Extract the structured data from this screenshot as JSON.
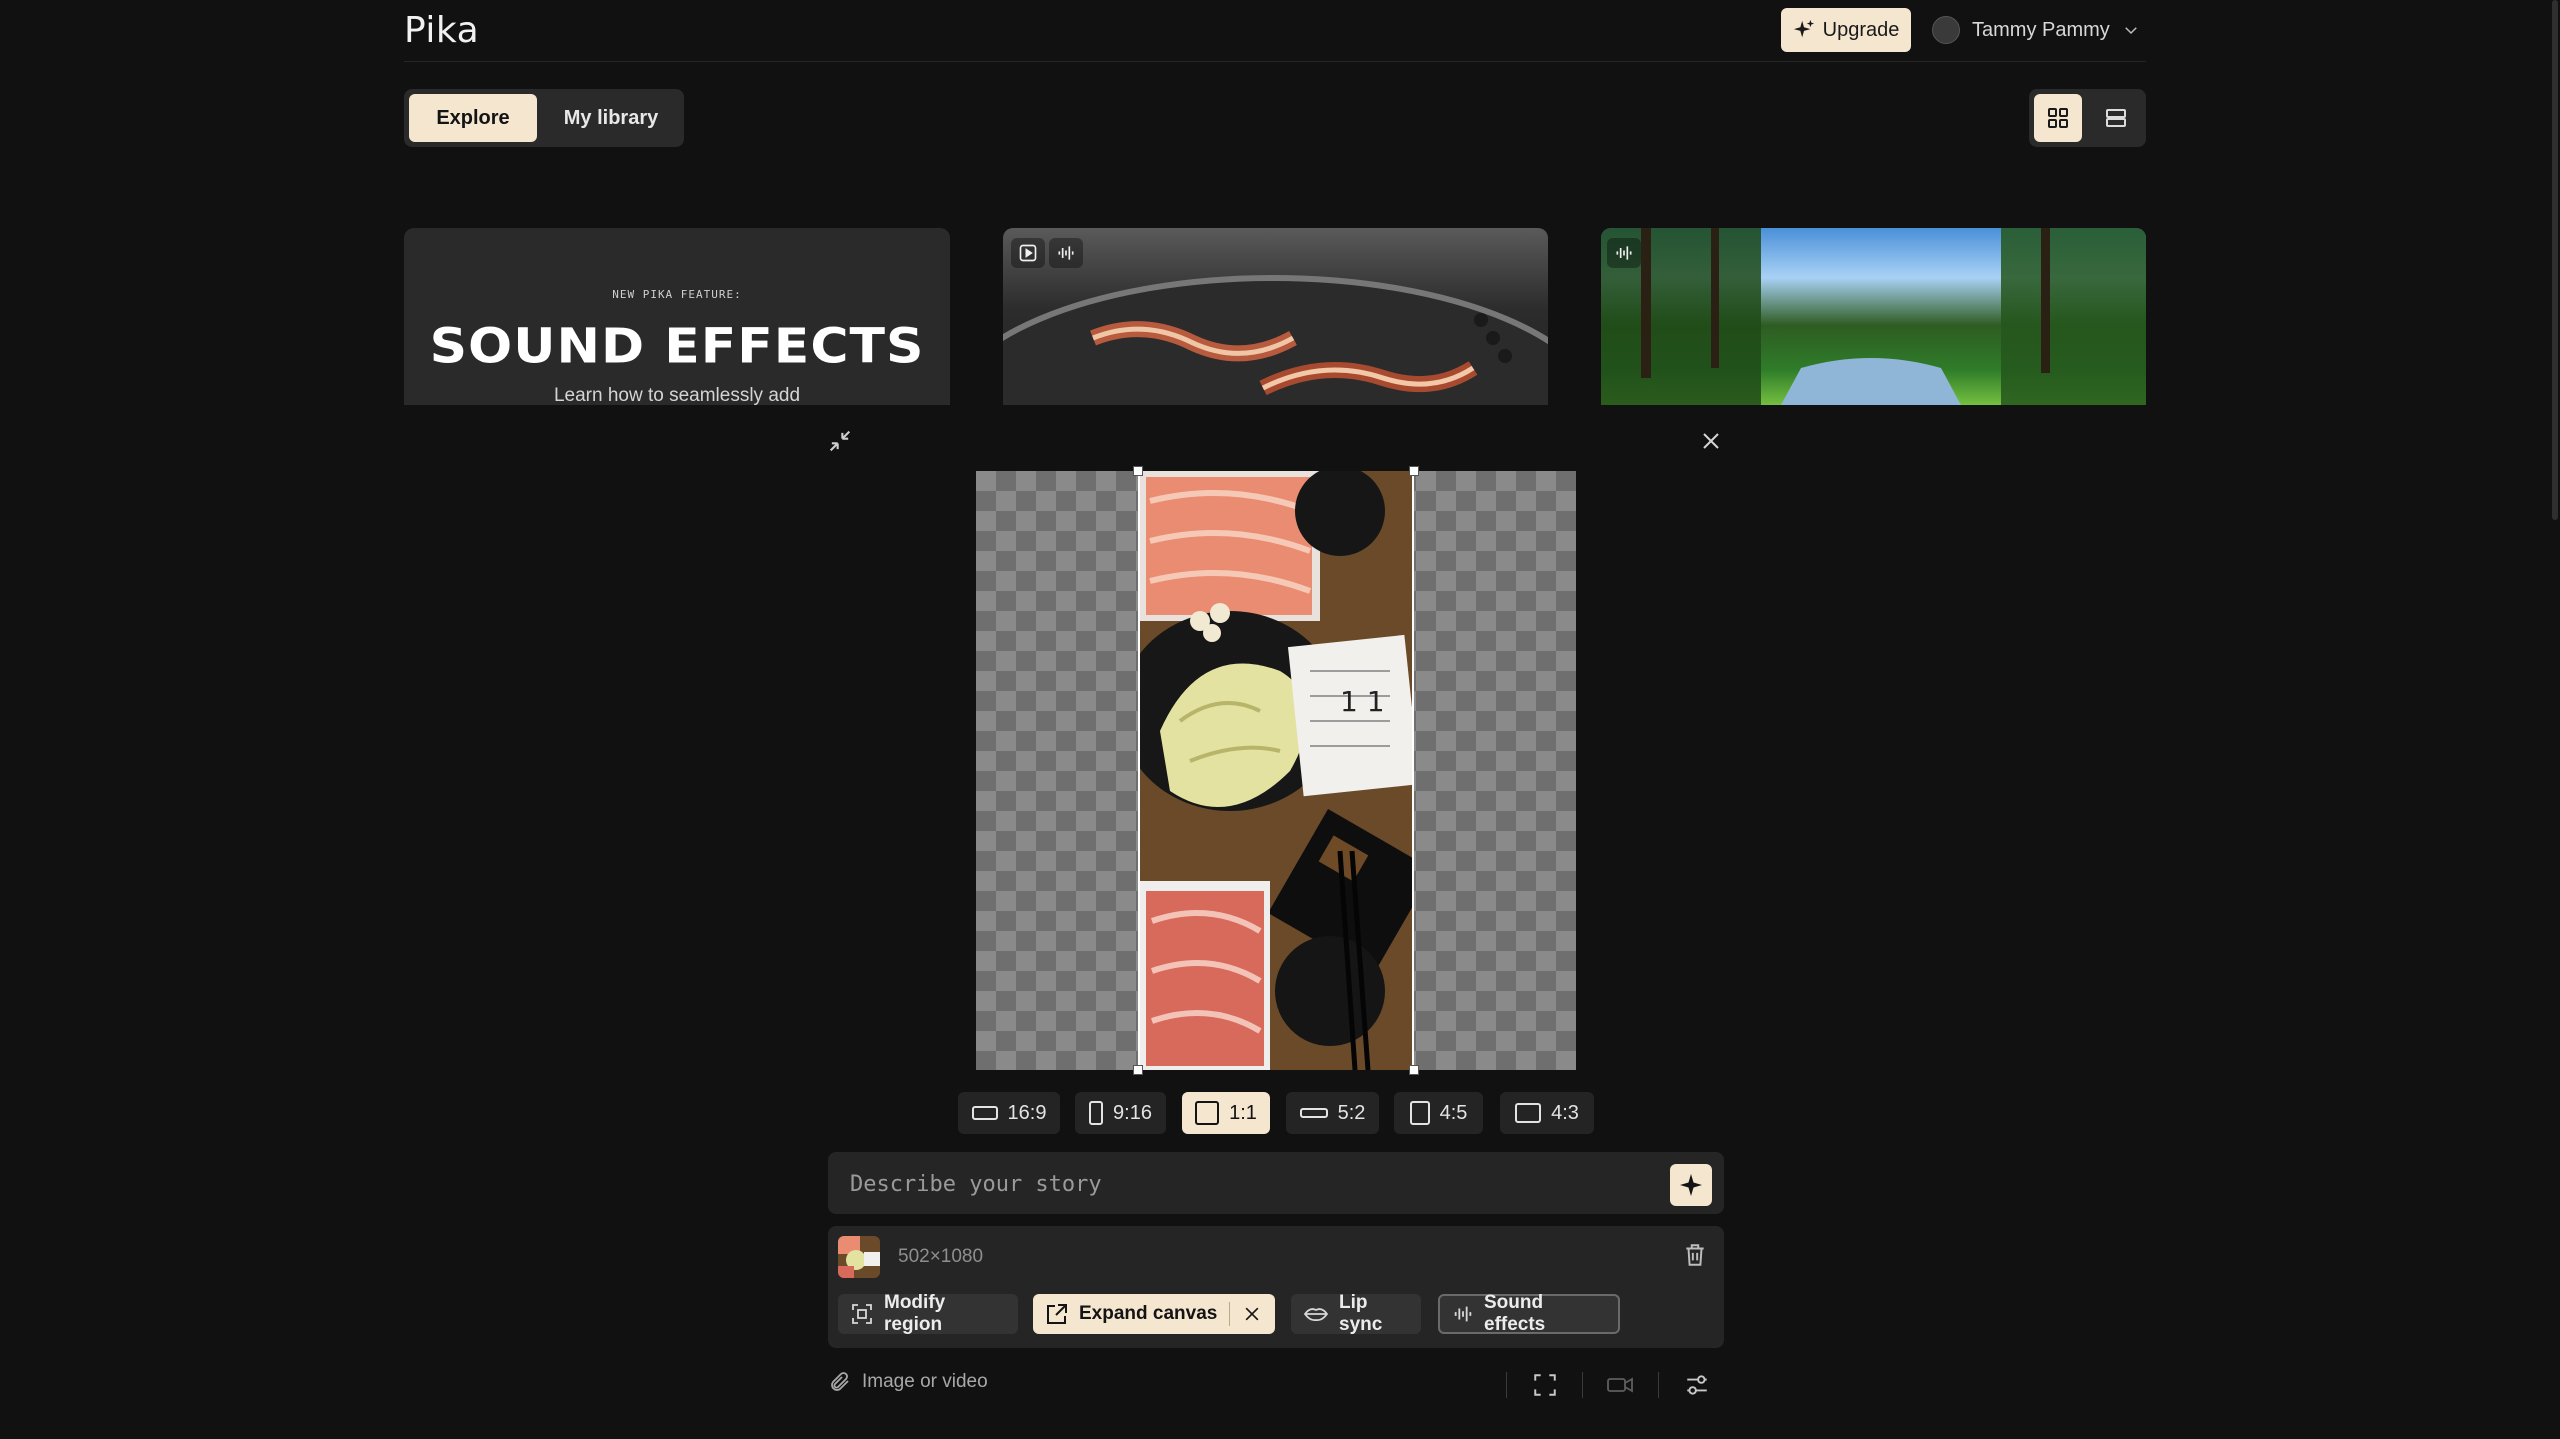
{
  "header": {
    "logo": "Pika",
    "upgrade_label": "Upgrade",
    "user_name": "Tammy Pammy"
  },
  "tabs": [
    {
      "label": "Explore",
      "active": true
    },
    {
      "label": "My library",
      "active": false
    }
  ],
  "feature_card": {
    "kicker": "NEW PIKA FEATURE:",
    "title": "SOUND EFFECTS",
    "description": "Learn how to seamlessly add"
  },
  "editor": {
    "ratios": [
      {
        "label": "16:9",
        "active": false
      },
      {
        "label": "9:16",
        "active": false
      },
      {
        "label": "1:1",
        "active": true
      },
      {
        "label": "5:2",
        "active": false
      },
      {
        "label": "4:5",
        "active": false
      },
      {
        "label": "4:3",
        "active": false
      }
    ],
    "prompt_placeholder": "Describe your story",
    "image_dims": "502×1080",
    "actions": {
      "modify_region": "Modify region",
      "expand_canvas": "Expand canvas",
      "lip_sync": "Lip sync",
      "sound_effects": "Sound effects"
    },
    "attach_label": "Image or video"
  },
  "colors": {
    "accent": "#f4e6cf",
    "background": "#111111",
    "surface": "#252525"
  }
}
